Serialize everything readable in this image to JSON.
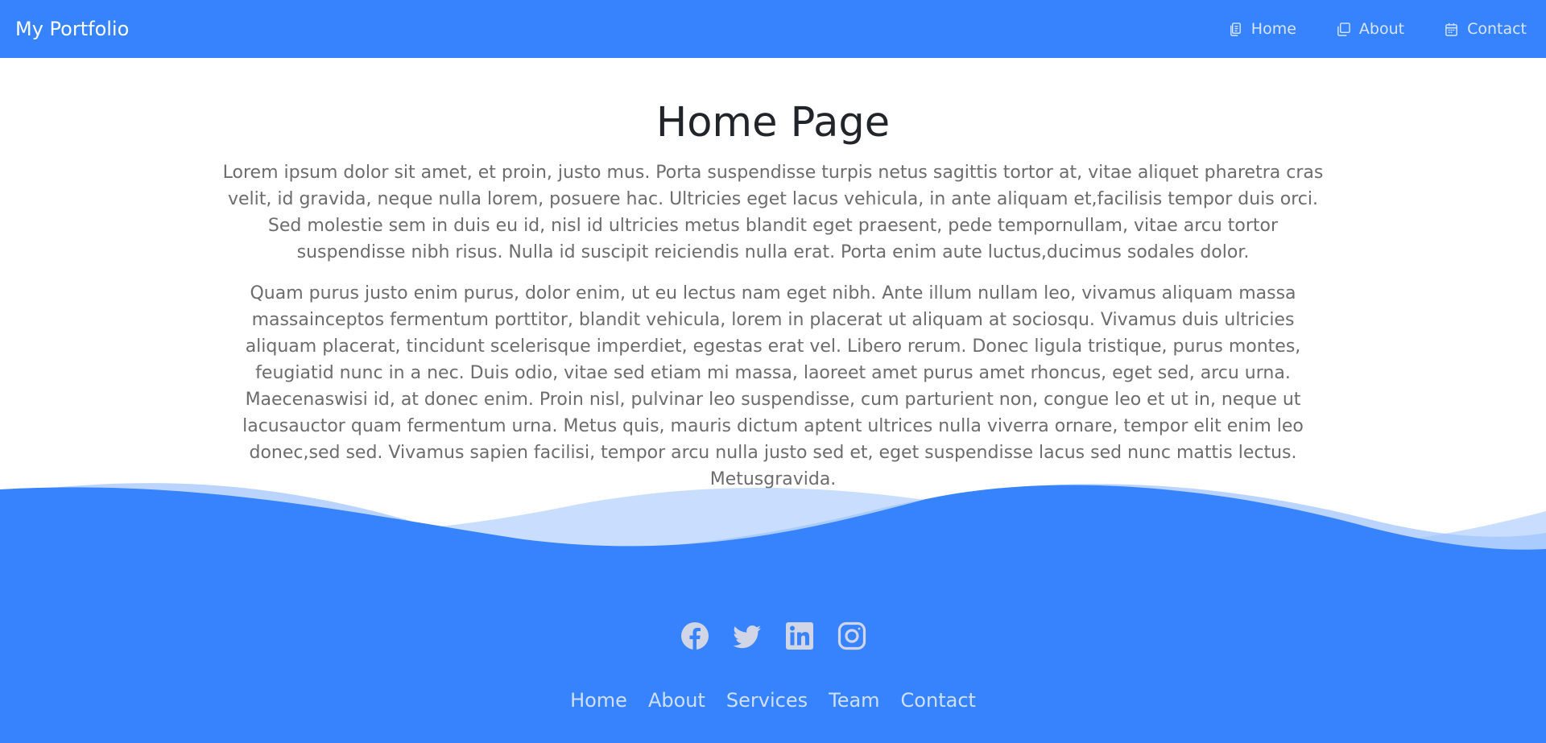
{
  "colors": {
    "primary": "#3783fe",
    "wave_light": "#9cc2fe",
    "text_muted": "#6c6c6c",
    "heading": "#212529"
  },
  "navbar": {
    "brand": "My Portfolio",
    "links": [
      {
        "label": "Home",
        "icon": "files-icon"
      },
      {
        "label": "About",
        "icon": "copy-icon"
      },
      {
        "label": "Contact",
        "icon": "calendar-icon"
      }
    ]
  },
  "main": {
    "title": "Home Page",
    "paragraphs": [
      "Lorem ipsum dolor sit amet, et proin, justo mus. Porta suspendisse turpis netus sagittis tortor at, vitae aliquet pharetra cras velit, id gravida, neque nulla lorem, posuere hac. Ultricies eget lacus vehicula, in ante aliquam et,facilisis tempor duis orci. Sed molestie sem in duis eu id, nisl id ultricies metus blandit eget praesent, pede tempornullam, vitae arcu tortor suspendisse nibh risus. Nulla id suscipit reiciendis nulla erat. Porta enim aute luctus,ducimus sodales dolor.",
      "Quam purus justo enim purus, dolor enim, ut eu lectus nam eget nibh. Ante illum nullam leo, vivamus aliquam massa massainceptos fermentum porttitor, blandit vehicula, lorem in placerat ut aliquam at sociosqu. Vivamus duis ultricies aliquam placerat, tincidunt scelerisque imperdiet, egestas erat vel. Libero rerum. Donec ligula tristique, purus montes, feugiatid nunc in a nec. Duis odio, vitae sed etiam mi massa, laoreet amet purus amet rhoncus, eget sed, arcu urna. Maecenaswisi id, at donec enim. Proin nisl, pulvinar leo suspendisse, cum parturient non, congue leo et ut in, neque ut lacusauctor quam fermentum urna. Metus quis, mauris dictum aptent ultrices nulla viverra ornare, tempor elit enim leo donec,sed sed. Vivamus sapien facilisi, tempor arcu nulla justo sed et, eget suspendisse lacus sed nunc mattis lectus. Metusgravida."
    ]
  },
  "footer": {
    "social": [
      "facebook-icon",
      "twitter-icon",
      "linkedin-icon",
      "instagram-icon"
    ],
    "menu": [
      "Home",
      "About",
      "Services",
      "Team",
      "Contact"
    ]
  }
}
